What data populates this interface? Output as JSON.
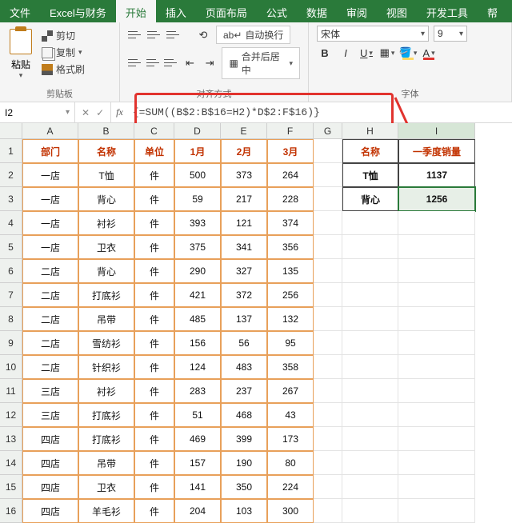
{
  "menu": {
    "file": "文件",
    "excel_finance": "Excel与财务",
    "home": "开始",
    "insert": "插入",
    "layout": "页面布局",
    "formulas": "公式",
    "data": "数据",
    "review": "审阅",
    "view": "视图",
    "developer": "开发工具",
    "help": "帮"
  },
  "ribbon": {
    "paste": "粘贴",
    "cut": "剪切",
    "copy": "复制",
    "format_painter": "格式刷",
    "clipboard_group": "剪贴板",
    "wrap": "自动换行",
    "merge": "合并后居中",
    "align_group": "对齐方式",
    "font_name": "宋体",
    "font_size": "9",
    "font_group": "字体"
  },
  "fx": {
    "namebox": "I2",
    "formula": "{=SUM((B$2:B$16=H2)*D$2:F$16)}"
  },
  "columns": [
    "A",
    "B",
    "C",
    "D",
    "E",
    "F",
    "G",
    "H",
    "I"
  ],
  "headers": {
    "dept": "部门",
    "name": "名称",
    "unit": "单位",
    "m1": "1月",
    "m2": "2月",
    "m3": "3月",
    "h_name": "名称",
    "h_total": "一季度销量"
  },
  "table": [
    {
      "dept": "一店",
      "name": "T恤",
      "unit": "件",
      "m1": "500",
      "m2": "373",
      "m3": "264"
    },
    {
      "dept": "一店",
      "name": "背心",
      "unit": "件",
      "m1": "59",
      "m2": "217",
      "m3": "228"
    },
    {
      "dept": "一店",
      "name": "衬衫",
      "unit": "件",
      "m1": "393",
      "m2": "121",
      "m3": "374"
    },
    {
      "dept": "一店",
      "name": "卫衣",
      "unit": "件",
      "m1": "375",
      "m2": "341",
      "m3": "356"
    },
    {
      "dept": "二店",
      "name": "背心",
      "unit": "件",
      "m1": "290",
      "m2": "327",
      "m3": "135"
    },
    {
      "dept": "二店",
      "name": "打底衫",
      "unit": "件",
      "m1": "421",
      "m2": "372",
      "m3": "256"
    },
    {
      "dept": "二店",
      "name": "吊带",
      "unit": "件",
      "m1": "485",
      "m2": "137",
      "m3": "132"
    },
    {
      "dept": "二店",
      "name": "雪纺衫",
      "unit": "件",
      "m1": "156",
      "m2": "56",
      "m3": "95"
    },
    {
      "dept": "二店",
      "name": "针织衫",
      "unit": "件",
      "m1": "124",
      "m2": "483",
      "m3": "358"
    },
    {
      "dept": "三店",
      "name": "衬衫",
      "unit": "件",
      "m1": "283",
      "m2": "237",
      "m3": "267"
    },
    {
      "dept": "三店",
      "name": "打底衫",
      "unit": "件",
      "m1": "51",
      "m2": "468",
      "m3": "43"
    },
    {
      "dept": "四店",
      "name": "打底衫",
      "unit": "件",
      "m1": "469",
      "m2": "399",
      "m3": "173"
    },
    {
      "dept": "四店",
      "name": "吊带",
      "unit": "件",
      "m1": "157",
      "m2": "190",
      "m3": "80"
    },
    {
      "dept": "四店",
      "name": "卫衣",
      "unit": "件",
      "m1": "141",
      "m2": "350",
      "m3": "224"
    },
    {
      "dept": "四店",
      "name": "羊毛衫",
      "unit": "件",
      "m1": "204",
      "m2": "103",
      "m3": "300"
    }
  ],
  "summary": [
    {
      "name": "T恤",
      "total": "1137"
    },
    {
      "name": "背心",
      "total": "1256"
    }
  ]
}
